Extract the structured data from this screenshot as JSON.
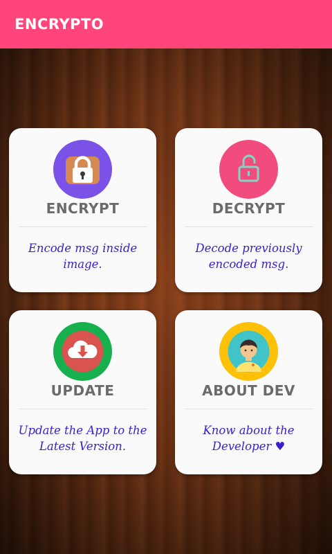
{
  "appbar": {
    "title": "ENCRYPTO"
  },
  "colors": {
    "appbar": "#ff4579",
    "card_text": "#6b6b6b",
    "desc_text": "#3a1ecf"
  },
  "cards": [
    {
      "label": "ENCRYPT",
      "desc": "Encode msg inside image.",
      "icon": "lock-closed-icon",
      "circle_color": "#7b52e8"
    },
    {
      "label": "DECRYPT",
      "desc": "Decode previously encoded msg.",
      "icon": "lock-open-icon",
      "circle_color": "#f24b7d"
    },
    {
      "label": "UPDATE",
      "desc": "Update the App to the Latest Version.",
      "icon": "cloud-download-icon",
      "circle_color": "#17b04e"
    },
    {
      "label": "ABOUT DEV",
      "desc": "Know about the Developer",
      "icon": "developer-avatar-icon",
      "circle_color": "#ffc107",
      "desc_suffix": "♥"
    }
  ]
}
